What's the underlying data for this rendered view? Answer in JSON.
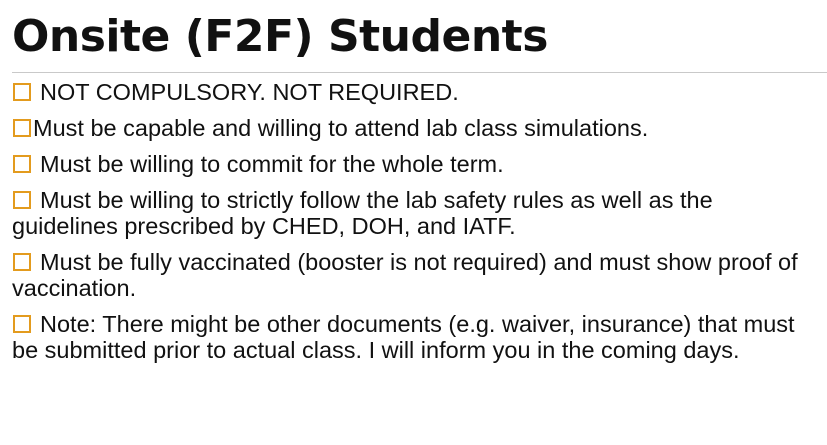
{
  "slide": {
    "title": "Onsite (F2F) Students",
    "bullet_color": "#e39b1e",
    "bullet_icon": "hollow-square-bullet",
    "bullets": [
      {
        "text": "NOT COMPULSORY. NOT REQUIRED."
      },
      {
        "text": "Must be capable and willing to attend lab class simulations."
      },
      {
        "text": "Must be willing to commit for the whole term."
      },
      {
        "text": "Must be willing to strictly follow the lab safety rules as well as the guidelines prescribed by CHED, DOH, and IATF."
      },
      {
        "text": "Must be fully vaccinated (booster is not required) and must show proof of vaccination."
      },
      {
        "text": "Note: There might be other documents (e.g. waiver, insurance) that must be submitted prior to actual class. I will inform you in the coming days."
      }
    ]
  }
}
